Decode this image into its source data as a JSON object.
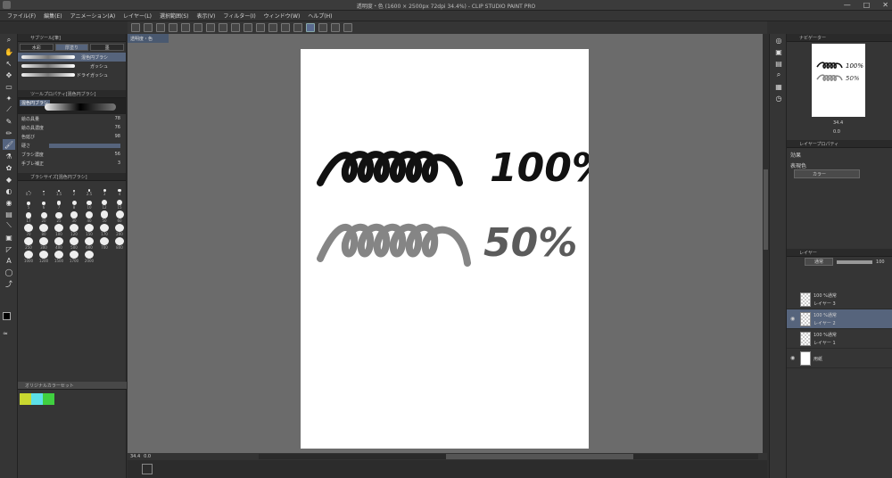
{
  "title": "透明度・色 (1600 × 2500px 72dpi 34.4%) - CLIP STUDIO PAINT PRO",
  "window_buttons": [
    "—",
    "□",
    "✕"
  ],
  "menu": [
    "ファイル(F)",
    "編集(E)",
    "アニメーション(A)",
    "レイヤー(L)",
    "選択範囲(S)",
    "表示(V)",
    "フィルター(I)",
    "ウィンドウ(W)",
    "ヘルプ(H)"
  ],
  "doc_tab": "透明度・色",
  "sub_tool": {
    "header": "サブツール[筆]",
    "tabs": [
      "水彩",
      "厚塗り",
      "墨"
    ],
    "brushes": [
      "混色円ブラシ",
      "ガッシュ",
      "ドライガッシュ"
    ]
  },
  "tool_props": {
    "header": "ツールプロパティ[混色円ブラシ]",
    "brush_name": "混色円ブラシ",
    "rows": [
      {
        "label": "絵の具量",
        "value": "78"
      },
      {
        "label": "絵の具濃度",
        "value": "76"
      },
      {
        "label": "色延び",
        "value": "98"
      },
      {
        "label": "硬さ",
        "value": ""
      },
      {
        "label": "ブラシ濃度",
        "value": "56"
      },
      {
        "label": "手ブレ補正",
        "value": "3"
      }
    ]
  },
  "brush_size": {
    "header": "ブラシサイズ[混色円ブラシ]",
    "sizes": [
      "0.7",
      "1",
      "1.5",
      "2",
      "2.5",
      "3",
      "4",
      "5",
      "6",
      "7",
      "8",
      "10",
      "12",
      "15",
      "17",
      "20",
      "25",
      "30",
      "40",
      "50",
      "60",
      "70",
      "80",
      "100",
      "120",
      "150",
      "170",
      "200",
      "250",
      "300",
      "400",
      "500",
      "600",
      "700",
      "800",
      "1000",
      "1200",
      "1500",
      "1700",
      "2000"
    ]
  },
  "color_set": {
    "name": "オリジナルカラーセット",
    "colors": [
      "#c8d830",
      "#5ce0e8",
      "#40d040"
    ]
  },
  "canvas_text": {
    "label_100": "100%",
    "label_50": "50%"
  },
  "status": {
    "zoom": "34.4",
    "angle": "0.0"
  },
  "navigator": {
    "header": "ナビゲーター",
    "zoom": "34.4",
    "angle": "0.0"
  },
  "layer_props": {
    "header": "レイヤープロパティ",
    "effect_label": "効果",
    "expression_label": "表現色",
    "expression_value": "カラー"
  },
  "layers_panel": {
    "header": "レイヤー",
    "blend": "通常",
    "opacity": "100",
    "layers": [
      {
        "mode": "100 %通常",
        "name": "レイヤー 3",
        "visible": false,
        "selected": false
      },
      {
        "mode": "100 %通常",
        "name": "レイヤー 2",
        "visible": true,
        "selected": true
      },
      {
        "mode": "100 %通常",
        "name": "レイヤー 1",
        "visible": false,
        "selected": false
      },
      {
        "mode": "",
        "name": "用紙",
        "visible": true,
        "selected": false
      }
    ]
  }
}
